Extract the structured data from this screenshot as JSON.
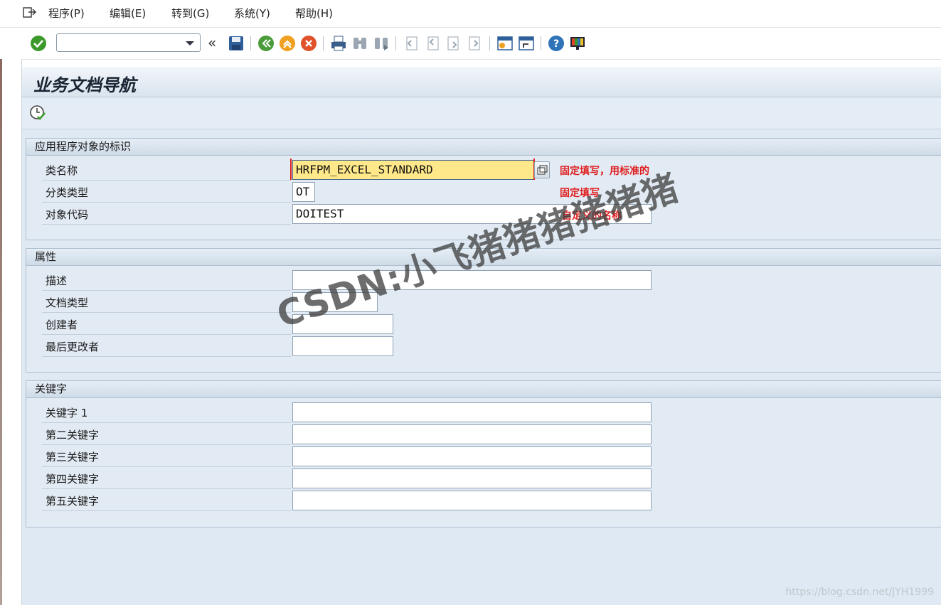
{
  "menu": {
    "items": [
      "程序(P)",
      "编辑(E)",
      "转到(G)",
      "系统(Y)",
      "帮助(H)"
    ]
  },
  "toolbar": {
    "command_value": "",
    "icons": [
      "ok-check-icon",
      "command-dropdown",
      "collapse-chevron-icon",
      "save-icon",
      "back-icon",
      "exit-icon",
      "cancel-icon",
      "print-icon",
      "find-icon",
      "find-next-icon",
      "first-page-icon",
      "prev-page-icon",
      "next-page-icon",
      "last-page-icon",
      "new-session-icon",
      "shortcut-icon",
      "help-icon",
      "customize-layout-icon"
    ]
  },
  "page": {
    "title": "业务文档导航"
  },
  "groups": {
    "ident": {
      "title": "应用程序对象的标识",
      "rows": [
        {
          "label": "类名称",
          "value": "HRFPM_EXCEL_STANDARD"
        },
        {
          "label": "分类类型",
          "value": "OT"
        },
        {
          "label": "对象代码",
          "value": "DOITEST"
        }
      ]
    },
    "attrs": {
      "title": "属性",
      "rows": [
        {
          "label": "描述",
          "value": ""
        },
        {
          "label": "文档类型",
          "value": ""
        },
        {
          "label": "创建者",
          "value": ""
        },
        {
          "label": "最后更改者",
          "value": ""
        }
      ]
    },
    "keywords": {
      "title": "关键字",
      "rows": [
        {
          "label": "关键字 1",
          "value": ""
        },
        {
          "label": "第二关键字",
          "value": ""
        },
        {
          "label": "第三关键字",
          "value": ""
        },
        {
          "label": "第四关键字",
          "value": ""
        },
        {
          "label": "第五关键字",
          "value": ""
        }
      ]
    }
  },
  "annotations": {
    "class_note": "固定填写，用标准的",
    "type_note": "固定填写",
    "code_note": "自定义的名称"
  },
  "watermark": "CSDN:小飞猪猪猪猪猪猪",
  "footer_url": "https://blog.csdn.net/JYH1999",
  "colors": {
    "annotation_red": "#e02020",
    "focus_yellow": "#ffe88a",
    "panel_blue": "#dfe9f3"
  }
}
